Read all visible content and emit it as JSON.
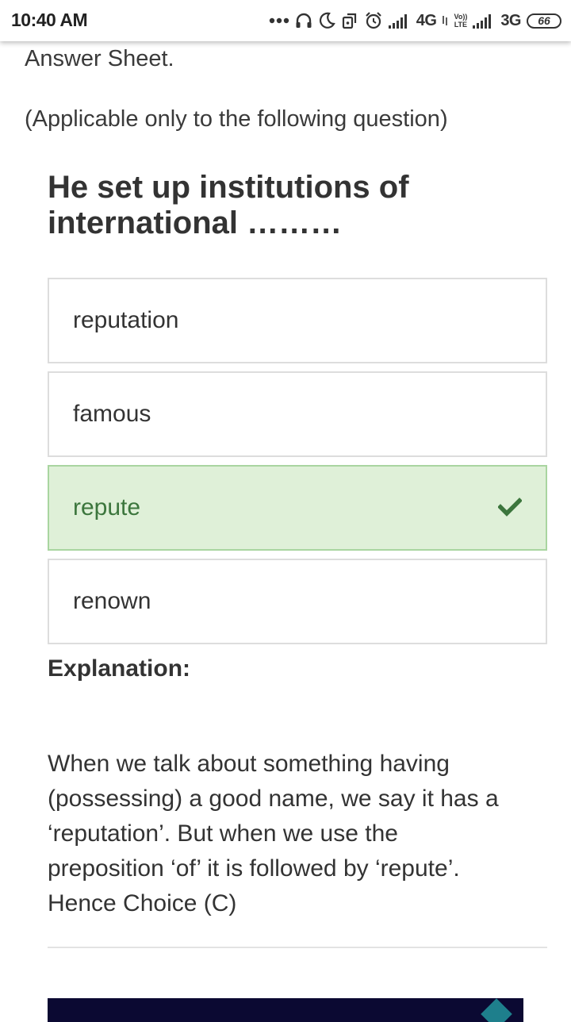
{
  "status_bar": {
    "time": "10:40 AM",
    "network_1": "4G",
    "volte_top": "Vo))",
    "volte_bottom": "LTE",
    "network_2": "3G",
    "battery": "66"
  },
  "intro": {
    "line1": "Answer Sheet.",
    "line2": "(Applicable only to the following question)"
  },
  "question": {
    "line1": "He set up institutions of",
    "line2": "international ………"
  },
  "options": [
    {
      "label": "reputation",
      "correct": false
    },
    {
      "label": "famous",
      "correct": false
    },
    {
      "label": "repute",
      "correct": true
    },
    {
      "label": "renown",
      "correct": false
    }
  ],
  "explanation": {
    "title": "Explanation:",
    "lines": [
      "When we talk about something having",
      "(possessing) a good name, we say it has a",
      "‘reputation’. But when we use the",
      "preposition ‘of’ it is followed by ‘repute’.",
      "Hence Choice (C)"
    ]
  },
  "colors": {
    "correct_bg": "#dff0d8",
    "correct_text": "#3c763d",
    "ad_bg": "#0b0932"
  }
}
